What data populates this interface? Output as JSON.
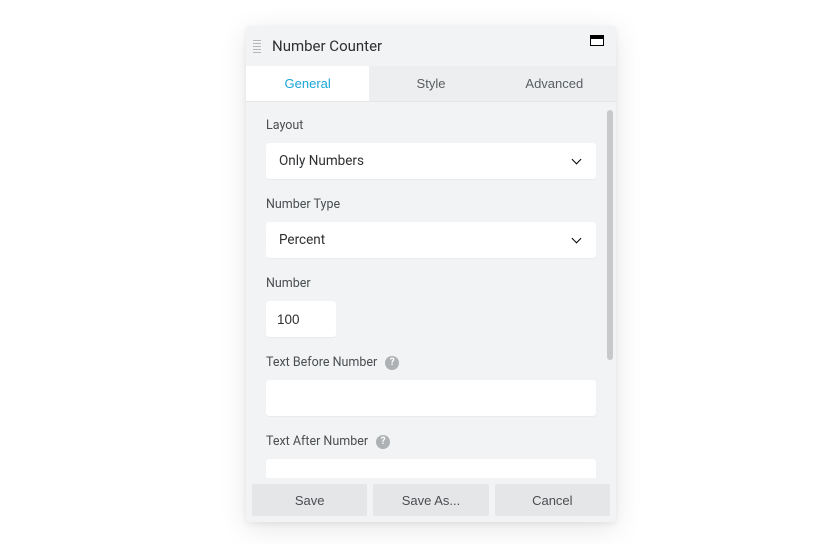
{
  "header": {
    "title": "Number Counter"
  },
  "tabs": [
    {
      "label": "General",
      "active": true
    },
    {
      "label": "Style",
      "active": false
    },
    {
      "label": "Advanced",
      "active": false
    }
  ],
  "fields": {
    "layout": {
      "label": "Layout",
      "value": "Only Numbers"
    },
    "numberType": {
      "label": "Number Type",
      "value": "Percent"
    },
    "number": {
      "label": "Number",
      "value": "100"
    },
    "textBefore": {
      "label": "Text Before Number",
      "value": ""
    },
    "textAfter": {
      "label": "Text After Number",
      "value": ""
    }
  },
  "footer": {
    "save": "Save",
    "saveAs": "Save As...",
    "cancel": "Cancel"
  }
}
